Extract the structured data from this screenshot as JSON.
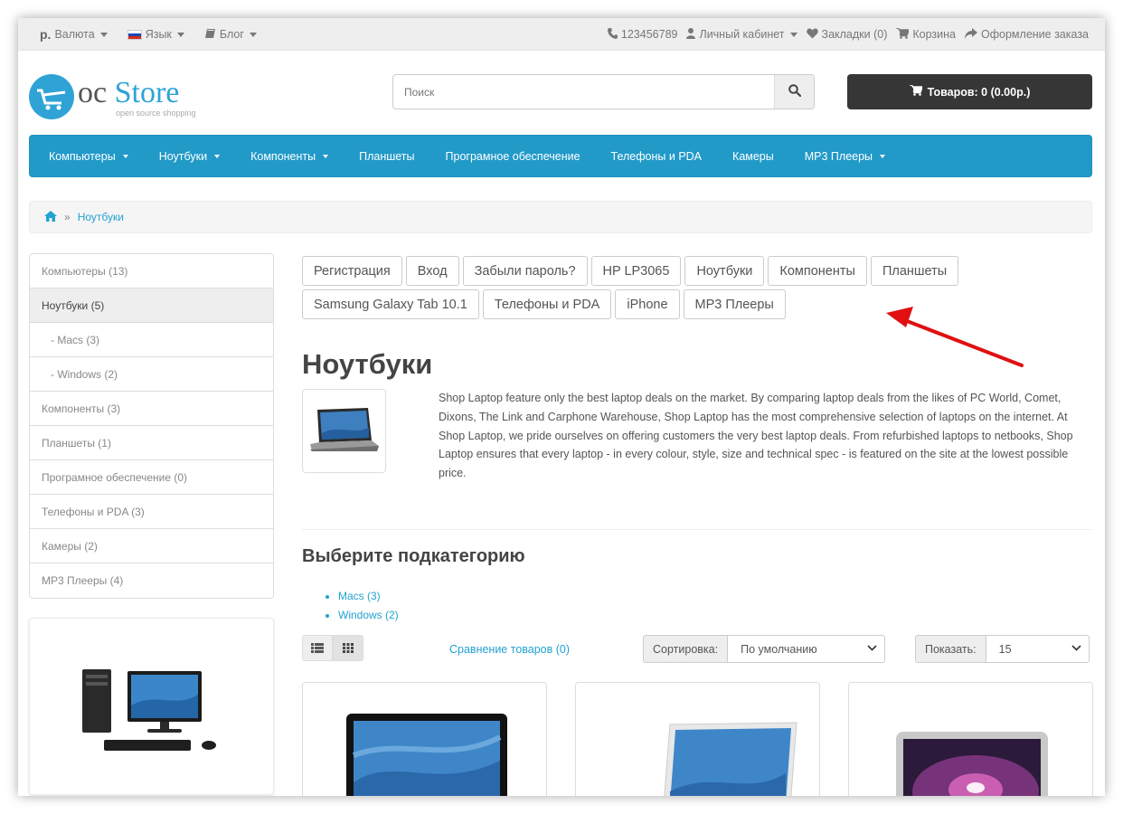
{
  "topbar": {
    "currency_symbol": "р.",
    "currency_label": "Валюта",
    "language_label": "Язык",
    "blog_label": "Блог",
    "phone": "123456789",
    "account_label": "Личный кабинет",
    "wishlist_label": "Закладки (0)",
    "cart_label": "Корзина",
    "checkout_label": "Оформление заказа"
  },
  "logo": {
    "part1": "oc",
    "part2": "Store",
    "tagline": "open source shopping"
  },
  "search": {
    "placeholder": "Поиск"
  },
  "cart": {
    "label": "Товаров: 0 (0.00р.)"
  },
  "menu": {
    "items": [
      {
        "label": "Компьютеры",
        "has_dropdown": true
      },
      {
        "label": "Ноутбуки",
        "has_dropdown": true
      },
      {
        "label": "Компоненты",
        "has_dropdown": true
      },
      {
        "label": "Планшеты",
        "has_dropdown": false
      },
      {
        "label": "Програмное обеспечение",
        "has_dropdown": false
      },
      {
        "label": "Телефоны и PDA",
        "has_dropdown": false
      },
      {
        "label": "Камеры",
        "has_dropdown": false
      },
      {
        "label": "MP3 Плееры",
        "has_dropdown": true
      }
    ]
  },
  "breadcrumb": {
    "current": "Ноутбуки"
  },
  "sidebar": {
    "items": [
      {
        "label": "Компьютеры (13)",
        "active": false,
        "sub": false
      },
      {
        "label": "Ноутбуки (5)",
        "active": true,
        "sub": false
      },
      {
        "label": "- Macs (3)",
        "active": false,
        "sub": true
      },
      {
        "label": "- Windows (2)",
        "active": false,
        "sub": true
      },
      {
        "label": "Компоненты (3)",
        "active": false,
        "sub": false
      },
      {
        "label": "Планшеты (1)",
        "active": false,
        "sub": false
      },
      {
        "label": "Програмное обеспечение (0)",
        "active": false,
        "sub": false
      },
      {
        "label": "Телефоны и PDA (3)",
        "active": false,
        "sub": false
      },
      {
        "label": "Камеры (2)",
        "active": false,
        "sub": false
      },
      {
        "label": "MP3 Плееры (4)",
        "active": false,
        "sub": false
      }
    ]
  },
  "tags": [
    "Регистрация",
    "Вход",
    "Забыли пароль?",
    "HP LP3065",
    "Ноутбуки",
    "Компоненты",
    "Планшеты",
    "Samsung Galaxy Tab 10.1",
    "Телефоны и PDA",
    "iPhone",
    "MP3 Плееры"
  ],
  "category": {
    "title": "Ноутбуки",
    "description": "Shop Laptop feature only the best laptop deals on the market. By comparing laptop deals from the likes of PC World, Comet, Dixons, The Link and Carphone Warehouse, Shop Laptop has the most comprehensive selection of laptops on the internet. At Shop Laptop, we pride ourselves on offering customers the very best laptop deals. From refurbished laptops to netbooks, Shop Laptop ensures that every laptop - in every colour, style, size and technical spec - is featured on the site at the lowest possible price."
  },
  "subcategories": {
    "heading": "Выберите подкатегорию",
    "items": [
      "Macs (3)",
      "Windows (2)"
    ]
  },
  "toolbar": {
    "compare_label": "Сравнение товаров (0)",
    "sort_label": "Сортировка:",
    "sort_value": "По умолчанию",
    "show_label": "Показать:",
    "show_value": "15"
  },
  "colors": {
    "accent": "#229ac8",
    "link": "#23a1d1",
    "cart_bg": "#363636",
    "annotation_arrow": "#e01010"
  }
}
